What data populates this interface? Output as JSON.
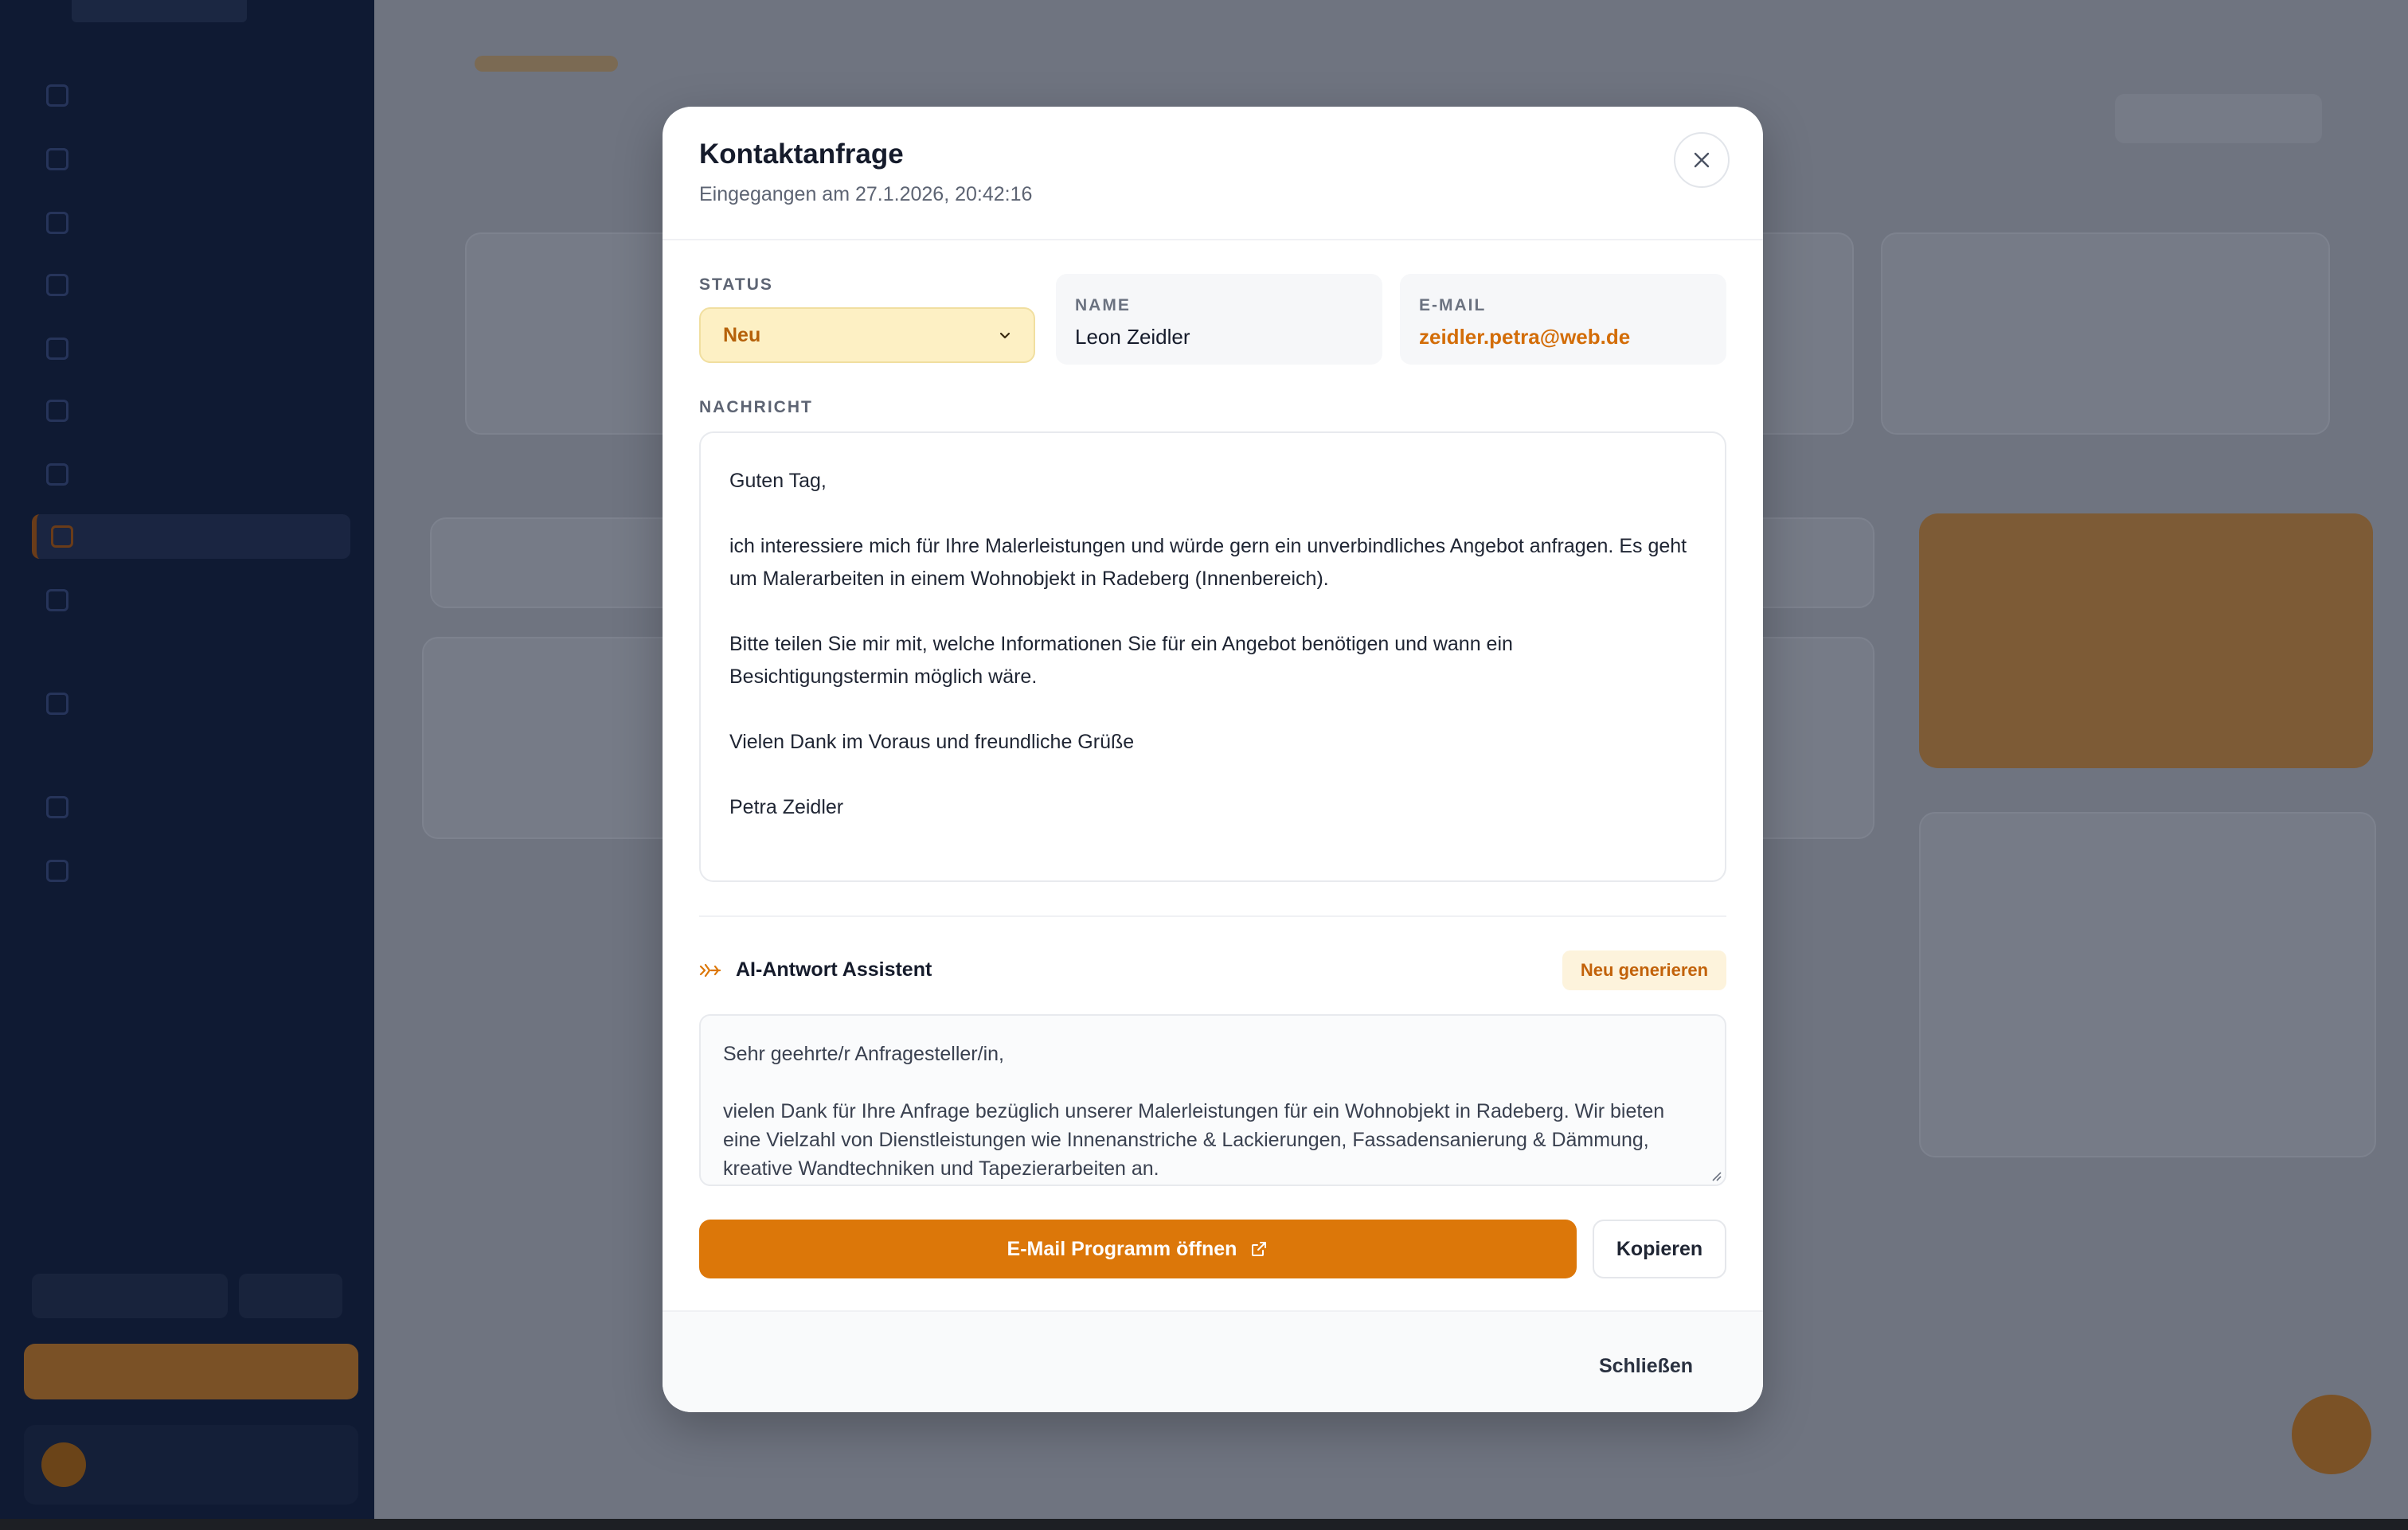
{
  "modal": {
    "title": "Kontaktanfrage",
    "received": "Eingegangen am 27.1.2026, 20:42:16",
    "status_label": "STATUS",
    "status_value": "Neu",
    "name_label": "NAME",
    "name_value": "Leon Zeidler",
    "email_label": "E-MAIL",
    "email_value": "zeidler.petra@web.de",
    "message_label": "NACHRICHT",
    "message": [
      "Guten Tag,",
      "ich interessiere mich für Ihre Malerleistungen und würde gern ein unverbindliches Angebot anfragen. Es geht um Malerarbeiten in einem Wohnobjekt in Radeberg (Innenbereich).",
      "Bitte teilen Sie mir mit, welche Informationen Sie für ein Angebot benötigen und wann ein Besichtigungstermin möglich wäre.",
      "Vielen Dank im Voraus und freundliche Grüße",
      "Petra Zeidler"
    ],
    "ai_title": "AI-Antwort Assistent",
    "ai_regenerate": "Neu generieren",
    "ai_reply": [
      "Sehr geehrte/r Anfragesteller/in,",
      "vielen Dank für Ihre Anfrage bezüglich unserer Malerleistungen für ein Wohnobjekt in Radeberg. Wir bieten eine Vielzahl von Dienstleistungen wie Innenanstriche & Lackierungen, Fassadensanierung & Dämmung, kreative Wandtechniken und Tapezierarbeiten an."
    ],
    "open_mail_label": "E-Mail Programm öffnen",
    "copy_label": "Kopieren",
    "close_label": "Schließen"
  },
  "colors": {
    "accent": "#dc7709",
    "status_bg": "#fdf0c4",
    "overlay": "#6f7480",
    "sidebar": "#0f1a33"
  },
  "icons": {
    "close": "close-icon",
    "chevron": "chevron-down-icon",
    "ai": "sparkle-icon",
    "external": "external-link-icon"
  }
}
